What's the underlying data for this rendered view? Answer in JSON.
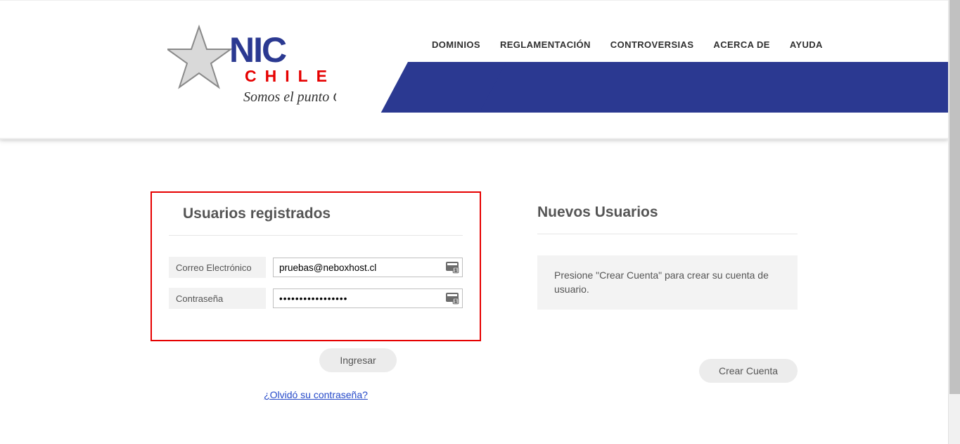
{
  "nav": {
    "items": [
      "DOMINIOS",
      "REGLAMENTACIÓN",
      "CONTROVERSIAS",
      "ACERCA DE",
      "AYUDA"
    ]
  },
  "logo": {
    "brand_top": "NIC",
    "brand_mid": "CHILE",
    "tagline": "Somos el punto CL"
  },
  "login": {
    "title": "Usuarios registrados",
    "email_label": "Correo Electrónico",
    "email_value": "pruebas@neboxhost.cl",
    "password_label": "Contraseña",
    "password_value": "•••••••••••••••••",
    "submit_label": "Ingresar",
    "forgot_label": "¿Olvidó su contraseña?"
  },
  "signup": {
    "title": "Nuevos Usuarios",
    "notice": "Presione \"Crear Cuenta\" para crear su cuenta de usuario.",
    "button_label": "Crear Cuenta"
  },
  "colors": {
    "brand_blue": "#2b3991",
    "brand_red": "#e60000",
    "highlight_border": "#e60000"
  }
}
